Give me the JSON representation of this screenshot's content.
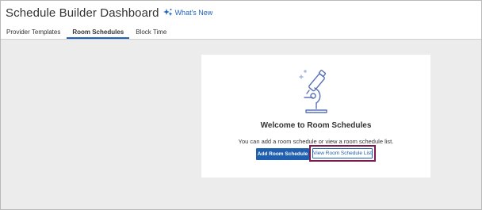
{
  "header": {
    "title": "Schedule Builder Dashboard",
    "whats_new_label": "What's New"
  },
  "tabs": [
    {
      "label": "Provider Templates",
      "active": false
    },
    {
      "label": "Room Schedules",
      "active": true
    },
    {
      "label": "Block Time",
      "active": false
    }
  ],
  "empty_state": {
    "heading": "Welcome to Room Schedules",
    "description": "You can add a room schedule or view a room schedule list.",
    "primary_button": "Add Room Schedule",
    "secondary_button": "View Room Schedule List"
  },
  "colors": {
    "accent": "#1f5fae",
    "highlight_border": "#7b1c4c",
    "background": "#ececec"
  },
  "icons": {
    "whats_new": "sparkle-icon",
    "illustration": "microscope-icon"
  }
}
